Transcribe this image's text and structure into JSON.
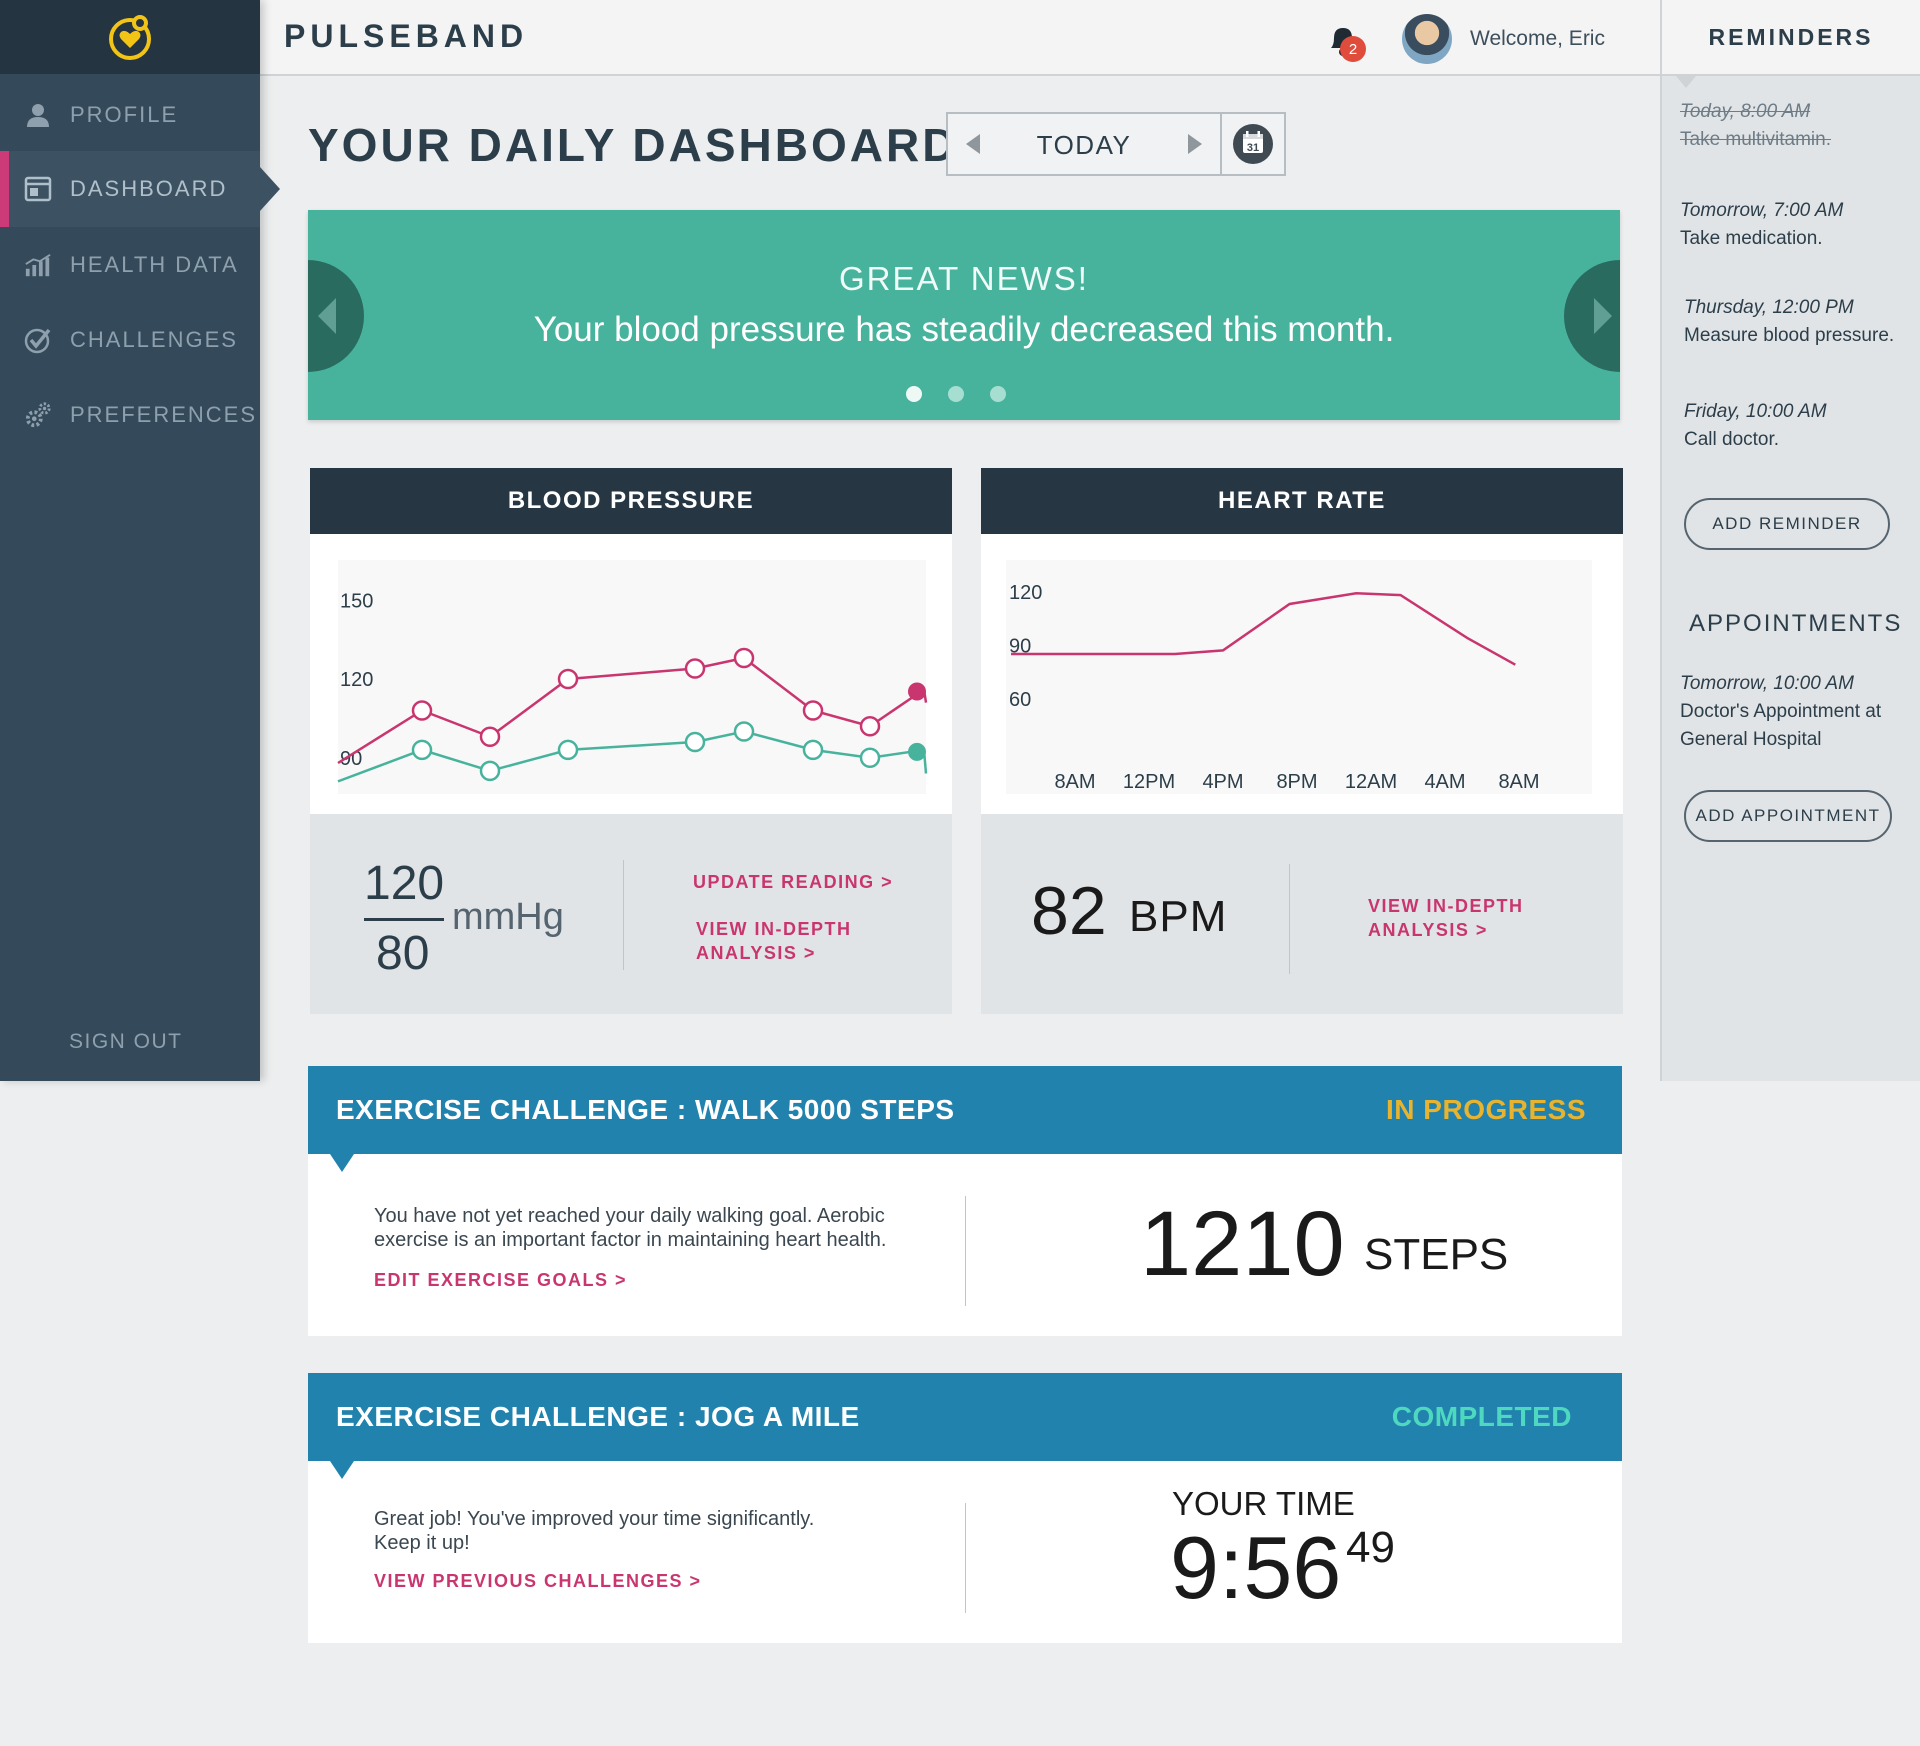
{
  "app": {
    "brand": "PULSEBAND"
  },
  "colors": {
    "accent_pink": "#c9366f",
    "teal": "#48b39d",
    "blue": "#2183ad",
    "in_progress": "#e8b32e",
    "completed": "#4fd8c0",
    "dark": "#263743"
  },
  "sidebar": {
    "logo_icon": "pulse-heart-logo",
    "items": [
      {
        "label": "PROFILE",
        "icon": "person-icon"
      },
      {
        "label": "DASHBOARD",
        "icon": "browser-window-icon",
        "active": true
      },
      {
        "label": "HEALTH DATA",
        "icon": "bar-chart-icon"
      },
      {
        "label": "CHALLENGES",
        "icon": "check-circle-icon"
      },
      {
        "label": "PREFERENCES",
        "icon": "gears-icon"
      }
    ],
    "signout": "SIGN OUT"
  },
  "header": {
    "notifications_count": "2",
    "welcome": "Welcome, Eric"
  },
  "page": {
    "title": "YOUR DAILY DASHBOARD",
    "date_label": "TODAY",
    "calendar_day": "31"
  },
  "banner": {
    "kicker": "GREAT NEWS!",
    "message": "Your blood pressure has steadily decreased this month.",
    "slide_count": 3,
    "active_slide": 0
  },
  "blood_pressure": {
    "title": "BLOOD PRESSURE",
    "systolic": "120",
    "diastolic": "80",
    "unit": "mmHg",
    "update_link": "UPDATE READING >",
    "analysis_link": [
      "VIEW IN-DEPTH",
      "ANALYSIS >"
    ]
  },
  "heart_rate": {
    "title": "HEART RATE",
    "value": "82",
    "unit": "BPM",
    "analysis_link": [
      "VIEW IN-DEPTH",
      "ANALYSIS >"
    ]
  },
  "chart_data": [
    {
      "type": "line",
      "ylim": [
        80,
        160
      ],
      "yticks": [
        150,
        120,
        90
      ],
      "series": [
        {
          "values": [
            88,
            108,
            98,
            120,
            124,
            128,
            108,
            102,
            116,
            111
          ],
          "color": "#c9366f"
        },
        {
          "values": [
            81,
            93,
            85,
            93,
            96,
            100,
            93,
            90,
            93,
            84
          ],
          "color": "#48b39d"
        }
      ]
    },
    {
      "type": "line",
      "categories": [
        "8AM",
        "12PM",
        "4PM",
        "8PM",
        "12AM",
        "4AM",
        "8AM"
      ],
      "ylim": [
        60,
        130
      ],
      "yticks": [
        120,
        90,
        60
      ],
      "series": [
        {
          "x": [
            0,
            1.35,
            2,
            2.9,
            3.8,
            4.4,
            5.3,
            5.95
          ],
          "values": [
            88,
            88,
            90,
            116,
            122,
            121,
            97,
            82
          ],
          "color": "#c9366f"
        }
      ]
    }
  ],
  "challenges": [
    {
      "title": "EXERCISE CHALLENGE : WALK 5000 STEPS",
      "status": "IN PROGRESS",
      "desc": [
        "You have not yet reached your daily walking goal. Aerobic",
        "exercise is an important factor in maintaining heart health."
      ],
      "link": "EDIT EXERCISE GOALS >",
      "value": "1210",
      "unit": "STEPS"
    },
    {
      "title": "EXERCISE CHALLENGE : JOG A MILE",
      "status": "COMPLETED",
      "desc": [
        "Great job! You've improved your time significantly.",
        "Keep it up!"
      ],
      "link": "VIEW PREVIOUS CHALLENGES >",
      "time_label": "YOUR TIME",
      "time": "9:56",
      "time_fraction": "49"
    }
  ],
  "reminders": {
    "title": "REMINDERS",
    "items": [
      {
        "when": "Today, 8:00 AM",
        "what": "Take multivitamin.",
        "done": true
      },
      {
        "when": "Tomorrow, 7:00 AM",
        "what": "Take medication."
      },
      {
        "when": "Thursday, 12:00 PM",
        "what": "Measure blood pressure."
      },
      {
        "when": "Friday, 10:00 AM",
        "what": "Call doctor."
      }
    ],
    "add_button": "ADD REMINDER"
  },
  "appointments": {
    "title": "APPOINTMENTS",
    "items": [
      {
        "when": "Tomorrow, 10:00 AM",
        "what": [
          "Doctor's Appointment at",
          "General Hospital"
        ]
      }
    ],
    "add_button": "ADD APPOINTMENT"
  }
}
